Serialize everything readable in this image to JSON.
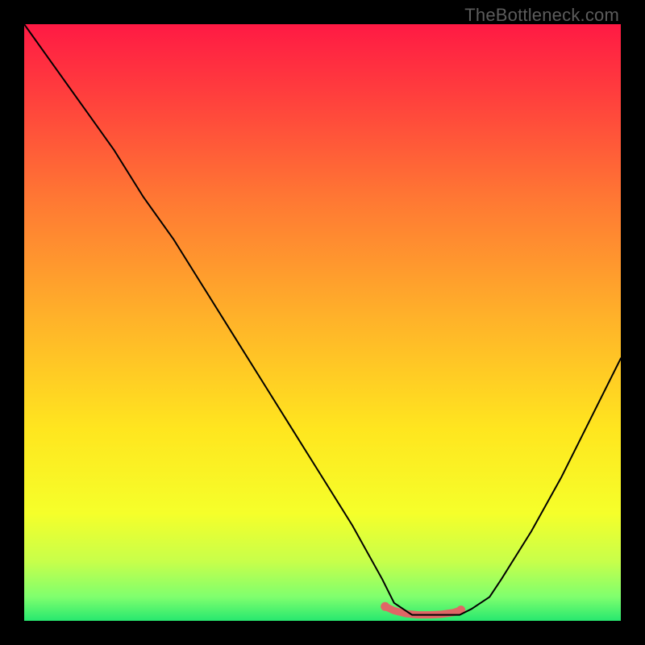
{
  "watermark": {
    "text": "TheBottleneck.com"
  },
  "chart_data": {
    "type": "line",
    "title": "",
    "xlabel": "",
    "ylabel": "",
    "xlim": [
      0,
      100
    ],
    "ylim": [
      0,
      100
    ],
    "grid": false,
    "legend": false,
    "background_gradient": {
      "stops": [
        {
          "offset": 0.0,
          "color": "#ff1a44"
        },
        {
          "offset": 0.12,
          "color": "#ff3f3d"
        },
        {
          "offset": 0.3,
          "color": "#ff7a33"
        },
        {
          "offset": 0.5,
          "color": "#ffb429"
        },
        {
          "offset": 0.68,
          "color": "#ffe61f"
        },
        {
          "offset": 0.82,
          "color": "#f5ff2a"
        },
        {
          "offset": 0.9,
          "color": "#c8ff4a"
        },
        {
          "offset": 0.96,
          "color": "#7fff6e"
        },
        {
          "offset": 1.0,
          "color": "#27e86f"
        }
      ]
    },
    "series": [
      {
        "name": "bottleneck-curve",
        "x": [
          0,
          5,
          10,
          15,
          20,
          25,
          30,
          35,
          40,
          45,
          50,
          55,
          60,
          62,
          65,
          70,
          73,
          75,
          78,
          80,
          85,
          90,
          95,
          100
        ],
        "y": [
          100,
          93,
          86,
          79,
          71,
          64,
          56,
          48,
          40,
          32,
          24,
          16,
          7,
          3,
          1,
          1,
          1,
          2,
          4,
          7,
          15,
          24,
          34,
          44
        ],
        "color": "#000000",
        "width": 2
      }
    ],
    "markers": [
      {
        "name": "flat-segment-highlight",
        "x": [
          60.5,
          62,
          64,
          66,
          68,
          70,
          72,
          73.2
        ],
        "y": [
          2.4,
          1.7,
          1.2,
          1.0,
          1.0,
          1.1,
          1.4,
          1.8
        ],
        "color": "#e06666",
        "width": 9,
        "endpoints": true
      }
    ]
  }
}
